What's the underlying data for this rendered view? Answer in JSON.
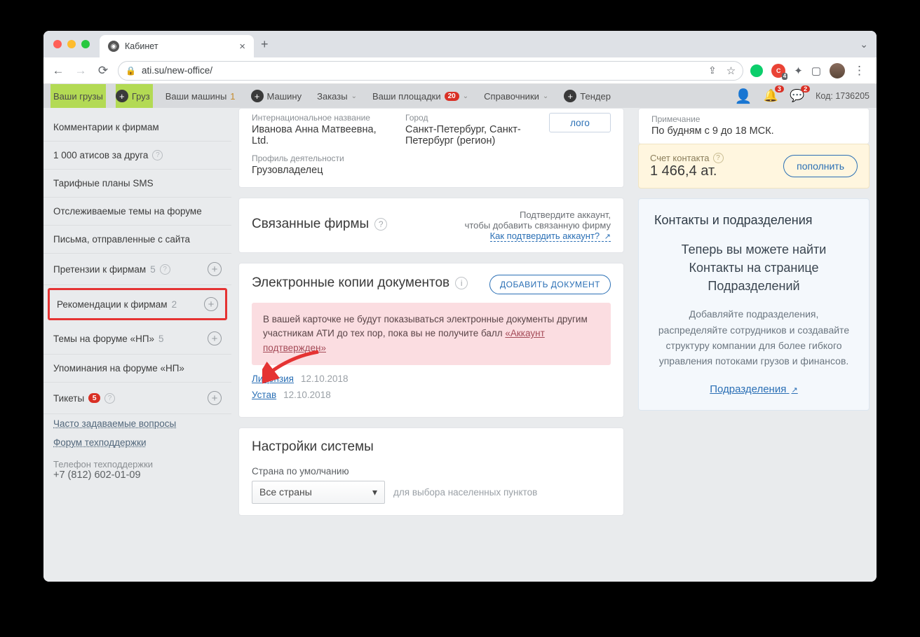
{
  "browser": {
    "tab_title": "Кабинет",
    "url": "ati.su/new-office/"
  },
  "ext_badge": "4",
  "appbar": {
    "seg1": "Ваши грузы",
    "add1": "Груз",
    "seg2": "Ваши машины",
    "seg2_count": "1",
    "add2": "Машину",
    "orders": "Заказы",
    "platforms": "Ваши площадки",
    "platforms_count": "20",
    "refs": "Справочники",
    "tender": "Тендер",
    "bell1": "3",
    "bell2": "2",
    "code_label": "Код:",
    "code": "1736205"
  },
  "sidebar": {
    "items": [
      {
        "label": "Комментарии к фирмам"
      },
      {
        "label": "1 000 атисов за друга",
        "help": true
      },
      {
        "label": "Тарифные планы SMS"
      },
      {
        "label": "Отслеживаемые темы на форуме"
      },
      {
        "label": "Письма, отправленные с сайта"
      },
      {
        "label": "Претензии к фирмам",
        "count": "5",
        "help": true,
        "plus": true
      },
      {
        "label": "Рекомендации к фирмам",
        "count": "2",
        "plus": true,
        "highlight": true
      },
      {
        "label": "Темы на форуме «НП»",
        "count": "5",
        "plus": true
      },
      {
        "label": "Упоминания на форуме «НП»"
      },
      {
        "label": "Тикеты",
        "badge": "5",
        "help": true,
        "plus": true
      }
    ],
    "faq": "Часто задаваемые вопросы",
    "forum": "Форум техподдержки",
    "phone_label": "Телефон техподдержки",
    "phone": "+7 (812) 602-01-09"
  },
  "profile": {
    "intl_label": "Интернациональное название",
    "intl_value": "Иванова Анна Матвеевна, Ltd.",
    "city_label": "Город",
    "city_value": "Санкт-Петербург, Санкт-Петербург (регион)",
    "activity_label": "Профиль деятельности",
    "activity_value": "Грузовладелец",
    "logo": "лого"
  },
  "linked": {
    "title": "Связанные фирмы",
    "note1": "Подтвердите аккаунт,",
    "note2": "чтобы добавить связанную фирму",
    "link": "Как подтвердить аккаунт?"
  },
  "docs": {
    "title": "Электронные копии документов",
    "add_btn": "ДОБАВИТЬ ДОКУМЕНТ",
    "warn_pre": "В вашей карточке не будут показываться электронные документы другим участникам АТИ до тех пор, пока вы не получите балл ",
    "warn_link": "«Аккаунт подтвержден»",
    "license": "Лицензия",
    "license_date": "12.10.2018",
    "charter": "Устав",
    "charter_date": "12.10.2018"
  },
  "settings": {
    "title": "Настройки системы",
    "country_label": "Страна по умолчанию",
    "country_value": "Все страны",
    "country_hint": "для выбора населенных пунктов"
  },
  "right": {
    "note_label": "Примечание",
    "note_value": "По будням с 9 до 18 МСК.",
    "balance_label": "Счет контакта",
    "balance_value": "1 466,4 ат.",
    "topup": "пополнить",
    "contacts_title": "Контакты и подразделения",
    "promo1": "Теперь вы можете найти Контакты на странице Подразделений",
    "promo2": "Добавляйте подразделения, распределяйте сотрудников и создавайте структуру компании для более гибкого управления потоками грузов и финансов.",
    "promo_link": "Подразделения"
  }
}
